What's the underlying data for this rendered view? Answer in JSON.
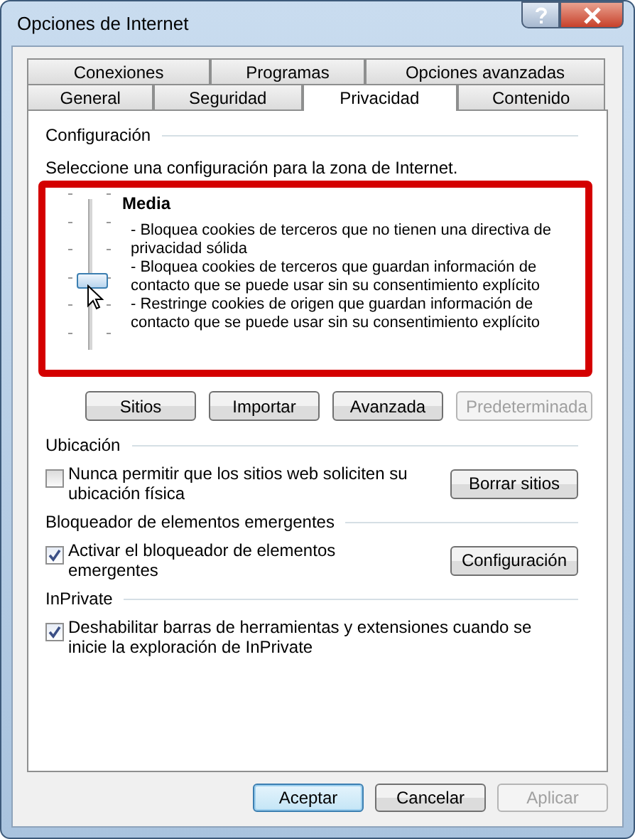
{
  "window": {
    "title": "Opciones de Internet"
  },
  "tab_rows": [
    [
      {
        "label": "Conexiones",
        "selected": false
      },
      {
        "label": "Programas",
        "selected": false
      },
      {
        "label": "Opciones avanzadas",
        "selected": false
      }
    ],
    [
      {
        "label": "General",
        "selected": false
      },
      {
        "label": "Seguridad",
        "selected": false
      },
      {
        "label": "Privacidad",
        "selected": true
      },
      {
        "label": "Contenido",
        "selected": false
      }
    ]
  ],
  "settings": {
    "heading": "Configuración",
    "instruction": "Seleccione una configuración para la zona de Internet.",
    "slider": {
      "level": 0.4
    },
    "level_name": "Media",
    "description": [
      "- Bloquea cookies de terceros que no tienen una directiva de privacidad sólida",
      "- Bloquea cookies de terceros que guardan información de contacto que se puede usar sin su consentimiento explícito",
      "- Restringe cookies de origen que guardan información de contacto que se puede usar sin su consentimiento explícito"
    ],
    "buttons": [
      {
        "label": "Sitios",
        "disabled": false
      },
      {
        "label": "Importar",
        "disabled": false
      },
      {
        "label": "Avanzada",
        "disabled": false
      },
      {
        "label": "Predeterminada",
        "disabled": true
      }
    ]
  },
  "sections": [
    {
      "heading": "Ubicación",
      "checkbox": {
        "label": "Nunca permitir que los sitios web soliciten su ubicación física",
        "checked": false
      },
      "button": "Borrar sitios"
    },
    {
      "heading": "Bloqueador de elementos emergentes",
      "checkbox": {
        "label": "Activar el bloqueador de elementos emergentes",
        "checked": true
      },
      "button": "Configuración"
    },
    {
      "heading": "InPrivate",
      "checkbox": {
        "label": "Deshabilitar barras de herramientas y extensiones cuando se inicie la exploración de InPrivate",
        "checked": true
      }
    }
  ],
  "footer_buttons": [
    {
      "label": "Aceptar",
      "default": true,
      "disabled": false
    },
    {
      "label": "Cancelar",
      "default": false,
      "disabled": false
    },
    {
      "label": "Aplicar",
      "default": false,
      "disabled": true
    }
  ]
}
